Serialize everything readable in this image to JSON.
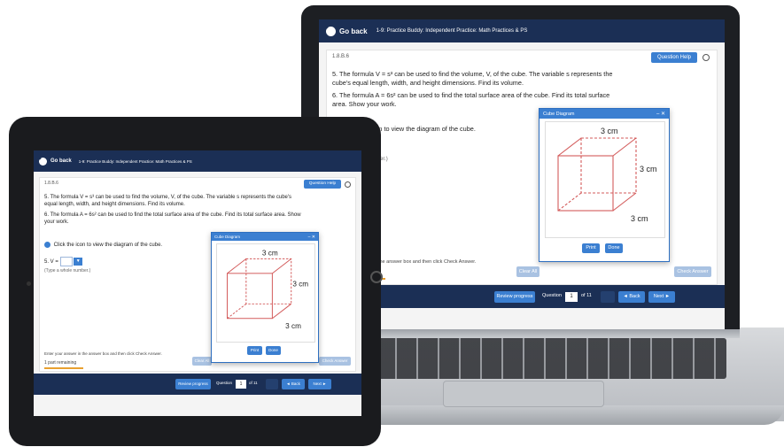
{
  "app": {
    "back_label": "Go back",
    "title": "1-9: Practice Buddy: Independent Practice: Math Practices & PS",
    "breadcrumb": "1.8.B.6",
    "question_help": "Question Help",
    "q5": "5. The formula V = s³ can be used to find the volume, V, of the cube. The variable s represents the cube's equal length, width, and height dimensions. Find its volume.",
    "q6": "6. The formula A = 6s² can be used to find the total surface area of the cube. Find its total surface area. Show your work.",
    "click_icon": "Click the icon to view the diagram of the cube.",
    "answer_label": "5. V =",
    "answer_hint": "(Type a whole number.)",
    "instructions": "Enter your answer in the answer box and then click Check Answer.",
    "remaining": "1 part remaining",
    "clear_all": "Clear All",
    "check_answer": "Check Answer",
    "review_progress": "Review progress",
    "question_label": "Question",
    "question_number": "1",
    "question_of": "of 11",
    "back": "◄ Back",
    "next": "Next ►"
  },
  "diagram": {
    "title": "Cube Diagram",
    "top_label": "3 cm",
    "right_label": "3 cm",
    "bottom_label": "3 cm",
    "print": "Print",
    "done": "Done"
  },
  "colors": {
    "nav": "#1b2f55",
    "accent": "#3b7fd1",
    "cube_edge": "#d35b5b"
  }
}
